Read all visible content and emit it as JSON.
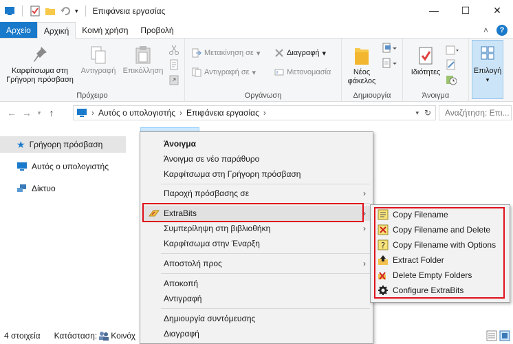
{
  "window": {
    "title": "Επιφάνεια εργασίας",
    "controls": [
      "—",
      "☐",
      "✕"
    ]
  },
  "tabs": [
    "Αρχείο",
    "Αρχική",
    "Κοινή χρήση",
    "Προβολή"
  ],
  "ribbon": {
    "clipboard": {
      "pin": "Καρφίτσωμα στη Γρήγορη πρόσβαση",
      "copy": "Αντιγραφή",
      "paste": "Επικόλληση",
      "group": "Πρόχειρο"
    },
    "organize": {
      "move": "Μετακίνηση σε",
      "copyto": "Αντιγραφή σε",
      "delete": "Διαγραφή",
      "rename": "Μετονομασία",
      "group": "Οργάνωση"
    },
    "new": {
      "folder_line1": "Νέος",
      "folder_line2": "φάκελος",
      "group": "Δημιουργία"
    },
    "open": {
      "properties": "Ιδιότητες",
      "group": "Άνοιγμα"
    },
    "select": {
      "label": "Επιλογή"
    }
  },
  "address": {
    "crumbs": [
      "Αυτός ο υπολογιστής",
      "Επιφάνεια εργασίας"
    ],
    "search_placeholder": "Αναζήτηση: Επι..."
  },
  "navpane": {
    "items": [
      "Γρήγορη πρόσβαση",
      "Αυτός ο υπολογιστής",
      "Δίκτυο"
    ]
  },
  "context_menu": {
    "items": [
      "Άνοιγμα",
      "Άνοιγμα σε νέο παράθυρο",
      "Καρφίτσωμα στη Γρήγορη πρόσβαση",
      "Παροχή πρόσβασης σε",
      "ExtraBits",
      "Συμπερίληψη στη βιβλιοθήκη",
      "Καρφίτσωμα στην Έναρξη",
      "Αποστολή προς",
      "Αποκοπή",
      "Αντιγραφή",
      "Δημιουργία συντόμευσης",
      "Διαγραφή"
    ]
  },
  "submenu": {
    "items": [
      "Copy Filename",
      "Copy Filename and Delete",
      "Copy Filename with Options",
      "Extract Folder",
      "Delete Empty Folders",
      "Configure ExtraBits"
    ]
  },
  "status": {
    "count": "4 στοιχεία",
    "state_label": "Κατάσταση:",
    "state_value": "Κοινόχ"
  },
  "colors": {
    "accent": "#1979ca",
    "highlight_box": "#e0101a"
  }
}
